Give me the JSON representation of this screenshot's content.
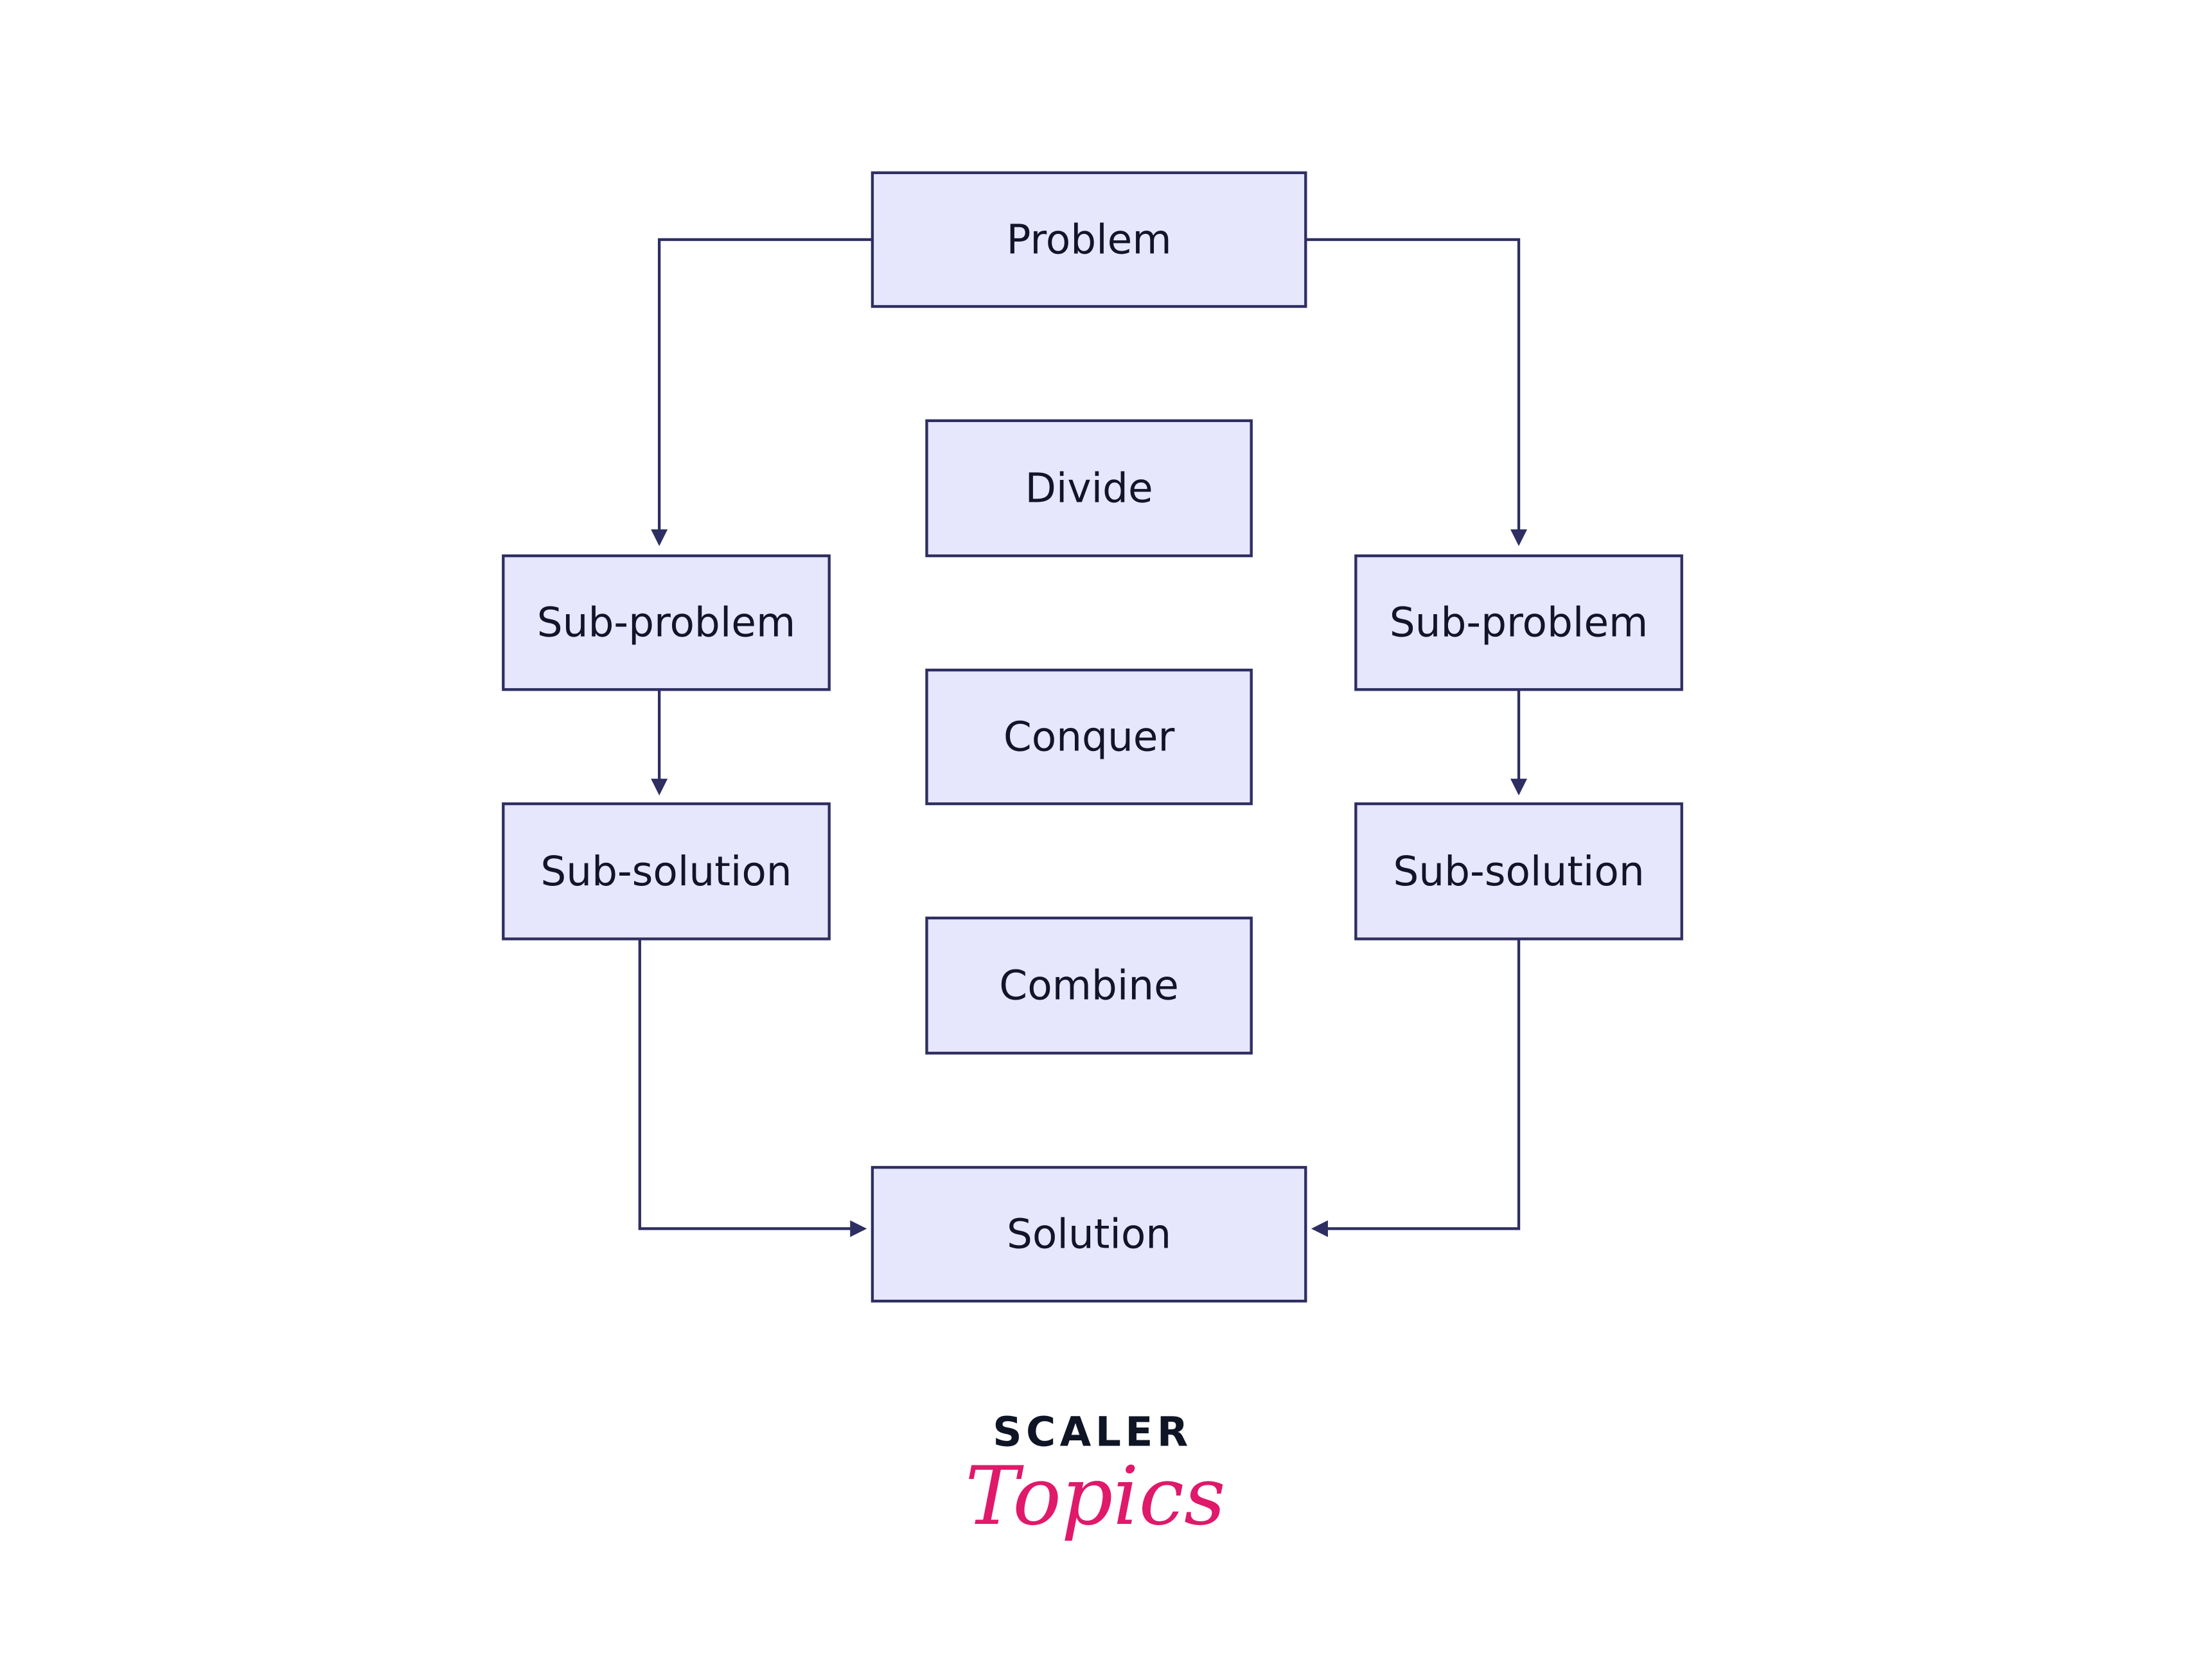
{
  "diagram": {
    "nodes": [
      {
        "id": "problem",
        "label": "Problem"
      },
      {
        "id": "divide",
        "label": "Divide"
      },
      {
        "id": "conquer",
        "label": "Conquer"
      },
      {
        "id": "combine",
        "label": "Combine"
      },
      {
        "id": "solution",
        "label": "Solution"
      },
      {
        "id": "subproblem-left",
        "label": "Sub-problem"
      },
      {
        "id": "subsolution-left",
        "label": "Sub-solution"
      },
      {
        "id": "subproblem-right",
        "label": "Sub-problem"
      },
      {
        "id": "subsolution-right",
        "label": "Sub-solution"
      }
    ],
    "edges": [
      {
        "from": "problem",
        "to": "subproblem-left"
      },
      {
        "from": "problem",
        "to": "subproblem-right"
      },
      {
        "from": "subproblem-left",
        "to": "subsolution-left"
      },
      {
        "from": "subproblem-right",
        "to": "subsolution-right"
      },
      {
        "from": "subsolution-left",
        "to": "solution"
      },
      {
        "from": "subsolution-right",
        "to": "solution"
      }
    ],
    "colors": {
      "box_fill": "#e6e6fc",
      "stroke": "#2e2e62",
      "text": "#13132a"
    }
  },
  "logo": {
    "line1": "SCALER",
    "line2": "Topics",
    "colors": {
      "line1": "#0f1524",
      "line2": "#e0196a"
    }
  }
}
